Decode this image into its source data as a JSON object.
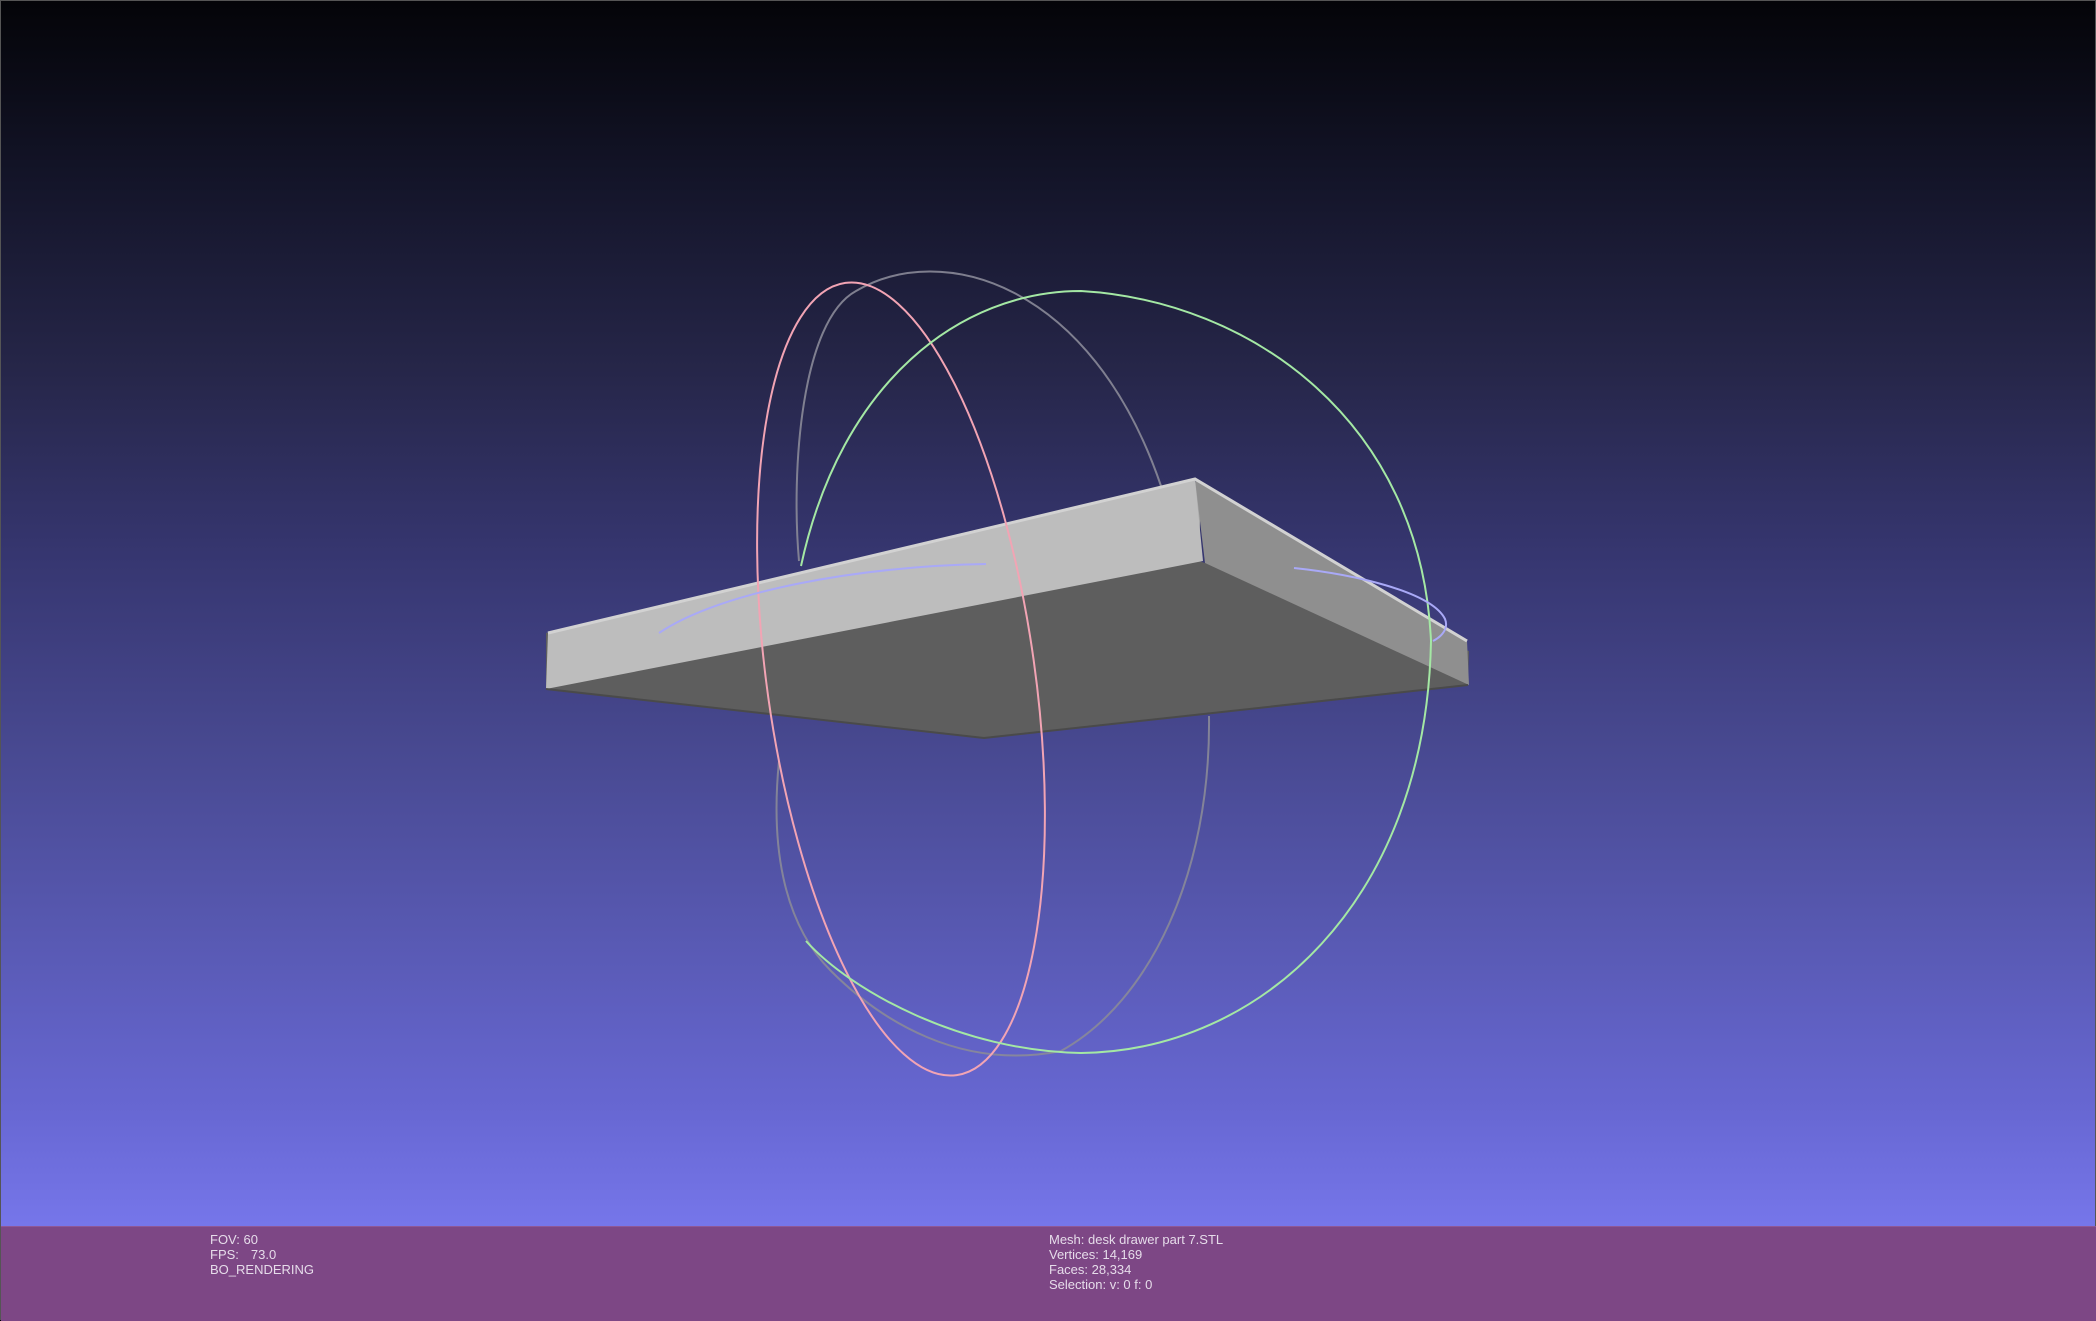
{
  "viewport": {
    "background_top": "#040408",
    "background_bottom": "#7a7af0"
  },
  "model": {
    "top_color": "#bdbdbd",
    "side_color": "#5e5e5e",
    "right_face_color": "#8f8f8f"
  },
  "trackball": {
    "rings": [
      {
        "name": "x-ring",
        "color": "#f2a4b4"
      },
      {
        "name": "y-ring",
        "color": "#a4e8a4"
      },
      {
        "name": "z-ring",
        "color": "#a9a9f7"
      }
    ]
  },
  "info_left": {
    "fov": "FOV: 60",
    "fps_label": "FPS:",
    "fps_value": "73.0",
    "render_mode": "BO_RENDERING"
  },
  "info_right": {
    "mesh": "Mesh: desk drawer part 7.STL",
    "vertices": "Vertices: 14,169",
    "faces": "Faces: 28,334",
    "selection": "Selection: v: 0 f: 0"
  }
}
